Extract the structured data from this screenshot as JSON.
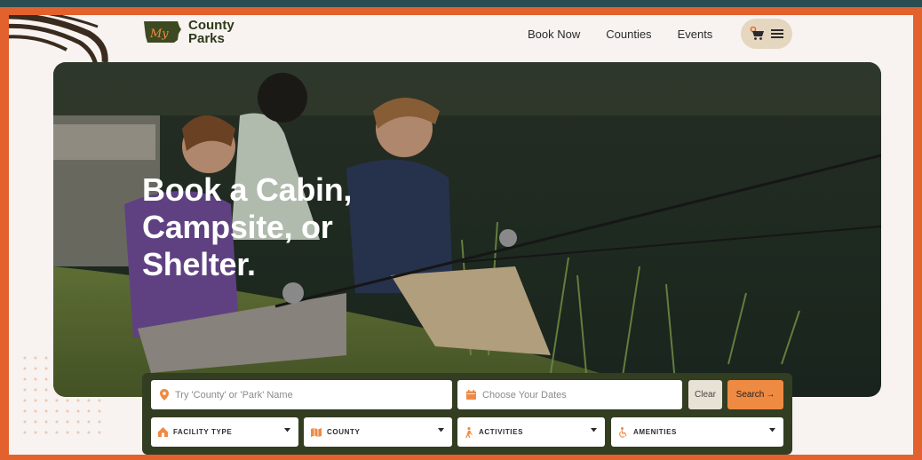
{
  "brand": {
    "name_line1": "County",
    "name_line2": "Parks",
    "logo_mark": "My"
  },
  "nav": {
    "items": [
      "Book Now",
      "Counties",
      "Events"
    ]
  },
  "header": {
    "cart_icon": "cart-icon",
    "menu_icon": "hamburger-icon"
  },
  "hero": {
    "title_line1": "Book a Cabin,",
    "title_line2": "Campsite, or",
    "title_line3": "Shelter."
  },
  "search": {
    "name_placeholder": "Try 'County' or 'Park' Name",
    "dates_placeholder": "Choose Your Dates",
    "clear_label": "Clear",
    "search_label": "Search",
    "search_arrow": "→"
  },
  "filters": [
    {
      "label": "FACILITY TYPE",
      "icon": "house-icon"
    },
    {
      "label": "COUNTY",
      "icon": "map-icon"
    },
    {
      "label": "ACTIVITIES",
      "icon": "hiker-icon"
    },
    {
      "label": "AMENITIES",
      "icon": "accessibility-icon"
    }
  ],
  "colors": {
    "accent": "#e2612d",
    "button": "#ef8a43",
    "panel": "#333d21",
    "frame": "#2a4d52"
  }
}
